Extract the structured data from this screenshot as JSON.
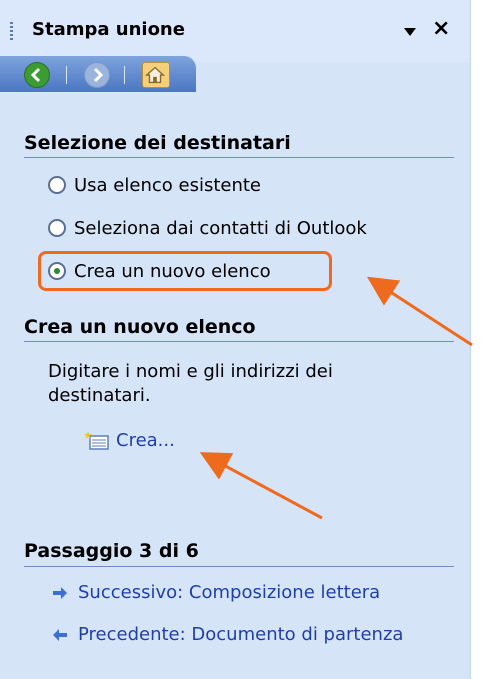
{
  "window": {
    "title": "Stampa unione"
  },
  "sections": {
    "recipients": {
      "title": "Selezione dei destinatari",
      "options": [
        {
          "label": "Usa elenco esistente",
          "checked": false
        },
        {
          "label": "Seleziona dai contatti di Outlook",
          "checked": false
        },
        {
          "label": "Crea un nuovo elenco",
          "checked": true
        }
      ]
    },
    "new_list": {
      "title": "Crea un nuovo elenco",
      "description_line1": "Digitare i nomi e gli indirizzi dei",
      "description_line2": "destinatari.",
      "create_link": "Crea..."
    },
    "step": {
      "title": "Passaggio 3 di 6",
      "next": "Successivo: Composizione lettera",
      "prev": "Precedente: Documento di partenza"
    }
  },
  "colors": {
    "annotation_orange": "#ee6b1e",
    "link_blue": "#1f3fa8",
    "pane_bg": "#d6e4f8"
  },
  "icons": [
    "grip-icon",
    "dropdown-arrow-icon",
    "close-icon",
    "back-icon",
    "forward-icon",
    "home-icon",
    "new-list-icon",
    "next-arrow-icon",
    "prev-arrow-icon"
  ]
}
